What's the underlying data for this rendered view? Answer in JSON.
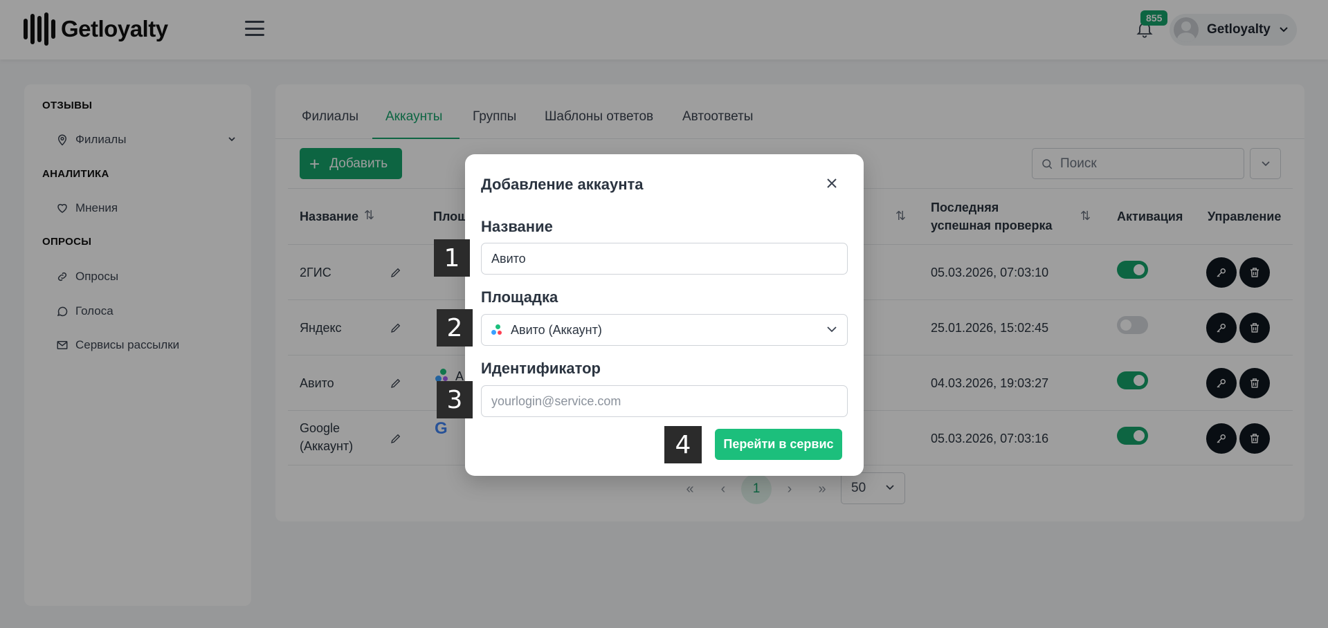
{
  "header": {
    "logo_text": "Getloyalty",
    "notifications_count": "855",
    "user_name": "Getloyalty"
  },
  "sidebar": {
    "sections": [
      {
        "title": "ОТЗЫВЫ",
        "items": [
          {
            "label": "Филиалы",
            "icon": "map-pin-icon"
          }
        ]
      },
      {
        "title": "АНАЛИТИКА",
        "items": [
          {
            "label": "Мнения",
            "icon": "heart-icon"
          }
        ]
      },
      {
        "title": "ОПРОСЫ",
        "items": [
          {
            "label": "Опросы",
            "icon": "link-icon"
          },
          {
            "label": "Голоса",
            "icon": "chat-icon"
          },
          {
            "label": "Сервисы рассылки",
            "icon": "mail-icon"
          }
        ]
      }
    ]
  },
  "main": {
    "tabs": [
      {
        "label": "Филиалы"
      },
      {
        "label": "Аккаунты"
      },
      {
        "label": "Группы"
      },
      {
        "label": "Шаблоны ответов"
      },
      {
        "label": "Автоответы"
      }
    ],
    "active_tab": "Аккаунты",
    "add_button": "Добавить",
    "search_placeholder": "Поиск",
    "table": {
      "columns": [
        "Название",
        "Площ",
        "Последняя успешная проверка",
        "Активация",
        "Управление"
      ],
      "rows": [
        {
          "name": "2ГИС",
          "last_check": "05.03.2026, 07:03:10",
          "active": true
        },
        {
          "name": "Яндекс",
          "last_check": "25.01.2026, 15:02:45",
          "active": false
        },
        {
          "name": "Авито",
          "platform_fragment": "А",
          "last_check": "04.03.2026, 19:03:27",
          "active": true
        },
        {
          "name": "Google (Аккаунт)",
          "platform_fragment": "G",
          "last_check": "05.03.2026, 07:03:16",
          "active": true
        }
      ]
    },
    "pagination": {
      "current_page": "1",
      "per_page": "50",
      "first": "«",
      "prev": "‹",
      "next": "›",
      "last": "»"
    }
  },
  "modal": {
    "title": "Добавление аккаунта",
    "name_label": "Название",
    "name_value": "Авито",
    "platform_label": "Площадка",
    "platform_value": "Авито (Аккаунт)",
    "identifier_label": "Идентификатор",
    "identifier_placeholder": "yourlogin@service.com",
    "submit_button": "Перейти в сервис"
  },
  "markers": [
    "1",
    "2",
    "3",
    "4"
  ],
  "colors": {
    "accent": "#15a36b",
    "button_green": "#1cbf7c",
    "dark": "#0f1720"
  }
}
